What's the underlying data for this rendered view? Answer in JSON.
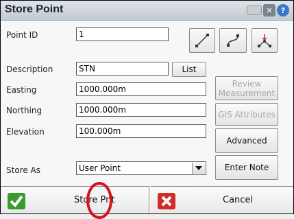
{
  "window": {
    "title": "Store Point"
  },
  "fields": {
    "point_id": {
      "label": "Point ID",
      "value": "1"
    },
    "description": {
      "label": "Description",
      "value": "STN"
    },
    "easting": {
      "label": "Easting",
      "value": "1000.000m"
    },
    "northing": {
      "label": "Northing",
      "value": "1000.000m"
    },
    "elevation": {
      "label": "Elevation",
      "value": "100.000m"
    },
    "store_as": {
      "label": "Store As",
      "value": "User Point"
    }
  },
  "buttons": {
    "list": "List",
    "review_line1": "Review",
    "review_line2": "Measurement",
    "gis": "GIS Attributes",
    "advanced": "Advanced",
    "enter_note": "Enter Note",
    "store_point": "Store Pnt",
    "cancel": "Cancel"
  },
  "icons": {
    "title_keyboard": "keyboard-icon",
    "title_close": "close-icon",
    "title_help": "help-icon",
    "line_tool": "line-tool-icon",
    "curve_tool": "curve-tool-icon",
    "point_tool": "point-from-points-icon",
    "store_icon": "check-icon",
    "cancel_icon": "x-icon"
  },
  "colors": {
    "title_bar": "#c3cad0",
    "check_green": "#3a9a2e",
    "cancel_red": "#d32b2b",
    "highlight_circle": "#d4141b"
  }
}
